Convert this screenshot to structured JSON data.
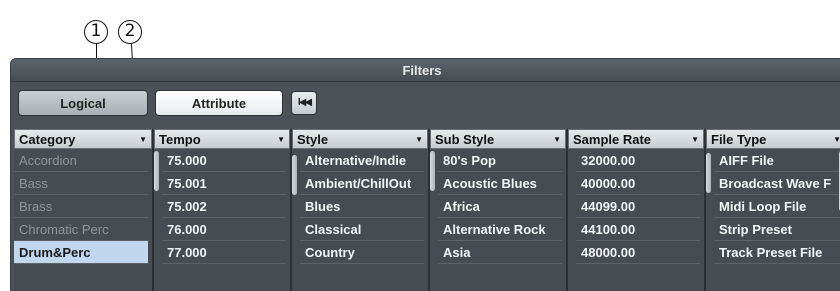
{
  "callouts": [
    "1",
    "2"
  ],
  "panel": {
    "title": "Filters"
  },
  "toolbar": {
    "logical_label": "Logical",
    "attribute_label": "Attribute",
    "reset_icon": "rewind-icon",
    "reset_glyph": "I◀◀"
  },
  "columns": [
    {
      "header": "Category",
      "items": [
        "Accordion",
        "Bass",
        "Brass",
        "Chromatic Perc",
        "Drum&Perc"
      ],
      "selected": "Drum&Perc"
    },
    {
      "header": "Tempo",
      "items": [
        "75.000",
        "75.001",
        "75.002",
        "76.000",
        "77.000"
      ]
    },
    {
      "header": "Style",
      "items": [
        "Alternative/Indie",
        "Ambient/ChillOut",
        "Blues",
        "Classical",
        "Country"
      ]
    },
    {
      "header": "Sub Style",
      "items": [
        "80's Pop",
        "Acoustic Blues",
        "Africa",
        "Alternative Rock",
        "Asia"
      ]
    },
    {
      "header": "Sample Rate",
      "items": [
        "32000.00",
        "40000.00",
        "44099.00",
        "44100.00",
        "48000.00"
      ]
    },
    {
      "header": "File Type",
      "items": [
        "AIFF File",
        "Broadcast Wave F",
        "Midi Loop File",
        "Strip Preset",
        "Track Preset File"
      ]
    }
  ],
  "colors": {
    "panel_bg": "#4b5157",
    "header_bg": "#d9dde1",
    "selected_bg": "#c0d7ee",
    "dim_text": "#8e959b"
  }
}
